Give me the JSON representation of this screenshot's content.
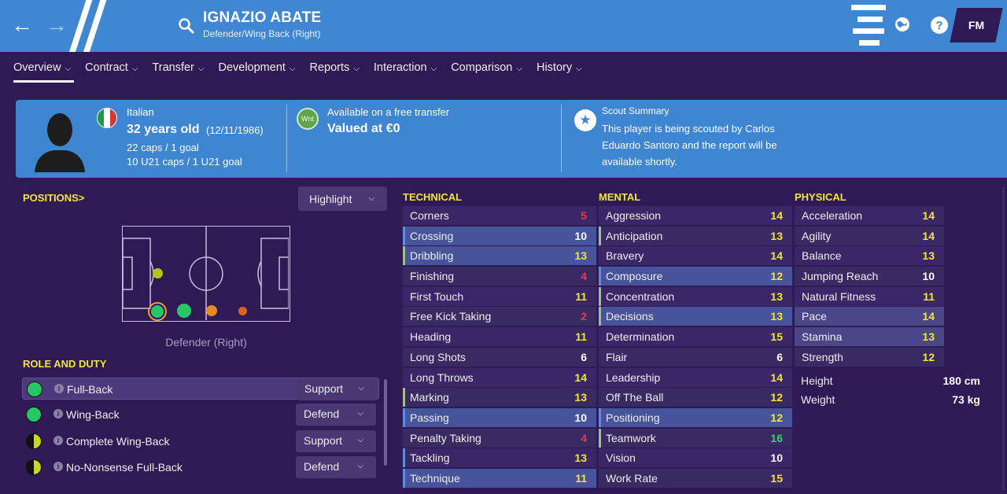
{
  "header": {
    "title": "IGNAZIO ABATE",
    "subtitle": "Defender/Wing Back (Right)",
    "logo": "FM"
  },
  "tabs": [
    {
      "label": "Overview"
    },
    {
      "label": "Contract"
    },
    {
      "label": "Transfer"
    },
    {
      "label": "Development"
    },
    {
      "label": "Reports"
    },
    {
      "label": "Interaction"
    },
    {
      "label": "Comparison"
    },
    {
      "label": "History"
    }
  ],
  "info": {
    "nationality": "Italian",
    "age": "32 years old",
    "dob": "(12/11/1986)",
    "caps": "22 caps / 1 goal",
    "u21": "10 U21 caps / 1 U21 goal",
    "wnt_badge": "Wnt",
    "transfer_status": "Available on a free transfer",
    "value": "Valued at €0",
    "scout_title": "Scout Summary",
    "scout_l1": "This player is being scouted by Carlos",
    "scout_l2": "Eduardo Santoro and the report will be",
    "scout_l3": "available shortly."
  },
  "positions": {
    "title": "POSITIONS",
    "arrow": ">",
    "highlight": "Highlight",
    "caption": "Defender (Right)"
  },
  "roles": {
    "title": "ROLE AND DUTY",
    "items": [
      {
        "name": "Full-Back",
        "duty": "Support"
      },
      {
        "name": "Wing-Back",
        "duty": "Defend"
      },
      {
        "name": "Complete Wing-Back",
        "duty": "Support"
      },
      {
        "name": "No-Nonsense Full-Back",
        "duty": "Defend"
      }
    ]
  },
  "attributes": {
    "technical_title": "TECHNICAL",
    "mental_title": "MENTAL",
    "physical_title": "PHYSICAL",
    "technical": [
      {
        "name": "Corners",
        "value": "5"
      },
      {
        "name": "Crossing",
        "value": "10"
      },
      {
        "name": "Dribbling",
        "value": "13"
      },
      {
        "name": "Finishing",
        "value": "4"
      },
      {
        "name": "First Touch",
        "value": "11"
      },
      {
        "name": "Free Kick Taking",
        "value": "2"
      },
      {
        "name": "Heading",
        "value": "11"
      },
      {
        "name": "Long Shots",
        "value": "6"
      },
      {
        "name": "Long Throws",
        "value": "14"
      },
      {
        "name": "Marking",
        "value": "13"
      },
      {
        "name": "Passing",
        "value": "10"
      },
      {
        "name": "Penalty Taking",
        "value": "4"
      },
      {
        "name": "Tackling",
        "value": "13"
      },
      {
        "name": "Technique",
        "value": "11"
      }
    ],
    "mental": [
      {
        "name": "Aggression",
        "value": "14"
      },
      {
        "name": "Anticipation",
        "value": "13"
      },
      {
        "name": "Bravery",
        "value": "14"
      },
      {
        "name": "Composure",
        "value": "12"
      },
      {
        "name": "Concentration",
        "value": "13"
      },
      {
        "name": "Decisions",
        "value": "13"
      },
      {
        "name": "Determination",
        "value": "15"
      },
      {
        "name": "Flair",
        "value": "6"
      },
      {
        "name": "Leadership",
        "value": "14"
      },
      {
        "name": "Off The Ball",
        "value": "12"
      },
      {
        "name": "Positioning",
        "value": "12"
      },
      {
        "name": "Teamwork",
        "value": "16"
      },
      {
        "name": "Vision",
        "value": "10"
      },
      {
        "name": "Work Rate",
        "value": "15"
      }
    ],
    "physical": [
      {
        "name": "Acceleration",
        "value": "14"
      },
      {
        "name": "Agility",
        "value": "14"
      },
      {
        "name": "Balance",
        "value": "13"
      },
      {
        "name": "Jumping Reach",
        "value": "10"
      },
      {
        "name": "Natural Fitness",
        "value": "11"
      },
      {
        "name": "Pace",
        "value": "14"
      },
      {
        "name": "Stamina",
        "value": "13"
      },
      {
        "name": "Strength",
        "value": "12"
      }
    ],
    "height_label": "Height",
    "height": "180 cm",
    "weight_label": "Weight",
    "weight": "73 kg"
  }
}
